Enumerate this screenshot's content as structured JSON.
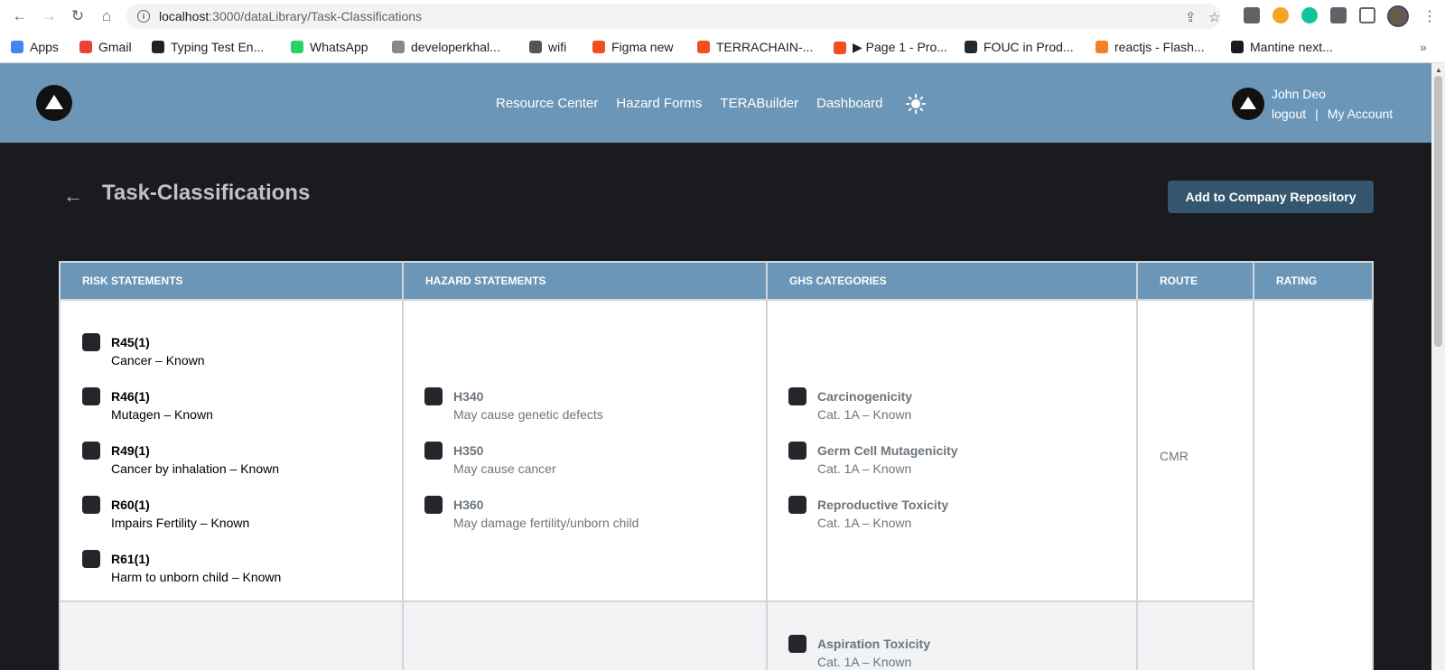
{
  "browser": {
    "url_host": "localhost",
    "url_path": ":3000/dataLibrary/Task-Classifications",
    "bookmarks": [
      {
        "label": "Apps",
        "color": "#4285f4"
      },
      {
        "label": "Gmail",
        "color": "#ea4335"
      },
      {
        "label": "Typing Test En...",
        "color": "#222222"
      },
      {
        "label": "WhatsApp",
        "color": "#25d366"
      },
      {
        "label": "developerkhal...",
        "color": "#888888"
      },
      {
        "label": "wifi",
        "color": "#555555"
      },
      {
        "label": "Figma new",
        "color": "#f24e1e"
      },
      {
        "label": "TERRACHAIN-...",
        "color": "#f24e1e"
      },
      {
        "label": "▶ Page 1 - Pro...",
        "color": "#f24e1e"
      },
      {
        "label": "FOUC in Prod...",
        "color": "#24292e"
      },
      {
        "label": "reactjs - Flash...",
        "color": "#f48024"
      },
      {
        "label": "Mantine next...",
        "color": "#1a1b1e"
      }
    ],
    "more_bookmarks": "»"
  },
  "header": {
    "nav": [
      "Resource Center",
      "Hazard Forms",
      "TERABuilder",
      "Dashboard"
    ],
    "user_name": "John Deo",
    "logout": "logout",
    "separator": "|",
    "my_account": "My Account",
    "accent_color": "#6b96b8"
  },
  "page": {
    "title": "Task-Classifications",
    "back_icon": "←",
    "repo_button": "Add to Company Repository"
  },
  "table": {
    "columns": [
      "RISK STATEMENTS",
      "HAZARD STATEMENTS",
      "GHS CATEGORIES",
      "ROUTE",
      "RATING"
    ],
    "risk_statements": [
      {
        "code": "R45(1)",
        "desc": "Cancer – Known"
      },
      {
        "code": "R46(1)",
        "desc": "Mutagen – Known"
      },
      {
        "code": "R49(1)",
        "desc": "Cancer by inhalation – Known"
      },
      {
        "code": "R60(1)",
        "desc": "Impairs Fertility – Known"
      },
      {
        "code": "R61(1)",
        "desc": "Harm to unborn child – Known"
      }
    ],
    "hazard_statements": [
      {
        "code": "H340",
        "desc": "May cause genetic defects"
      },
      {
        "code": "H350",
        "desc": "May cause cancer"
      },
      {
        "code": "H360",
        "desc": "May damage fertility/unborn child"
      }
    ],
    "ghs_categories": [
      {
        "code": "Carcinogenicity",
        "desc": "Cat. 1A – Known"
      },
      {
        "code": "Germ Cell Mutagenicity",
        "desc": "Cat. 1A – Known"
      },
      {
        "code": "Reproductive Toxicity",
        "desc": "Cat. 1A – Known"
      }
    ],
    "route": "CMR",
    "row2_ghs": [
      {
        "code": "Aspiration Toxicity",
        "desc": "Cat. 1A – Known"
      }
    ]
  }
}
